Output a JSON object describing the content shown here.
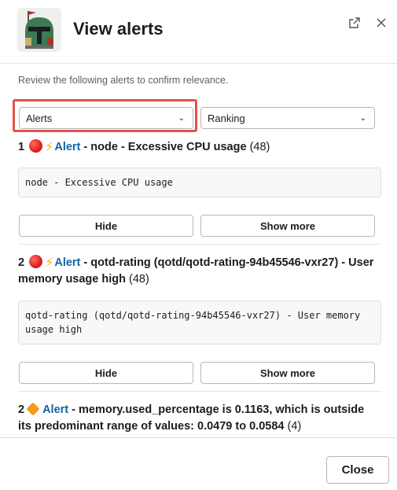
{
  "modal": {
    "title": "View alerts",
    "subtitle": "Review the following alerts to confirm relevance.",
    "close_label": "Close"
  },
  "filters": {
    "type_select": "Alerts",
    "sort_select": "Ranking"
  },
  "alerts": [
    {
      "rank": "1",
      "link": "Alert",
      "text": " - node - Excessive CPU usage",
      "count": "(48)",
      "detail": "node - Excessive CPU usage",
      "hide_label": "Hide",
      "more_label": "Show more"
    },
    {
      "rank": "2",
      "link": "Alert",
      "text": " - qotd-rating (qotd/qotd-rating-94b45546-vxr27) - User memory usage high",
      "count": "(48)",
      "detail": "qotd-rating (qotd/qotd-rating-94b45546-vxr27) - User memory usage high",
      "hide_label": "Hide",
      "more_label": "Show more"
    },
    {
      "rank": "2",
      "link": "Alert",
      "text": " - memory.used_percentage is 0.1163, which is outside its predominant range of values: 0.0479 to 0.0584",
      "count": "(4)"
    }
  ]
}
